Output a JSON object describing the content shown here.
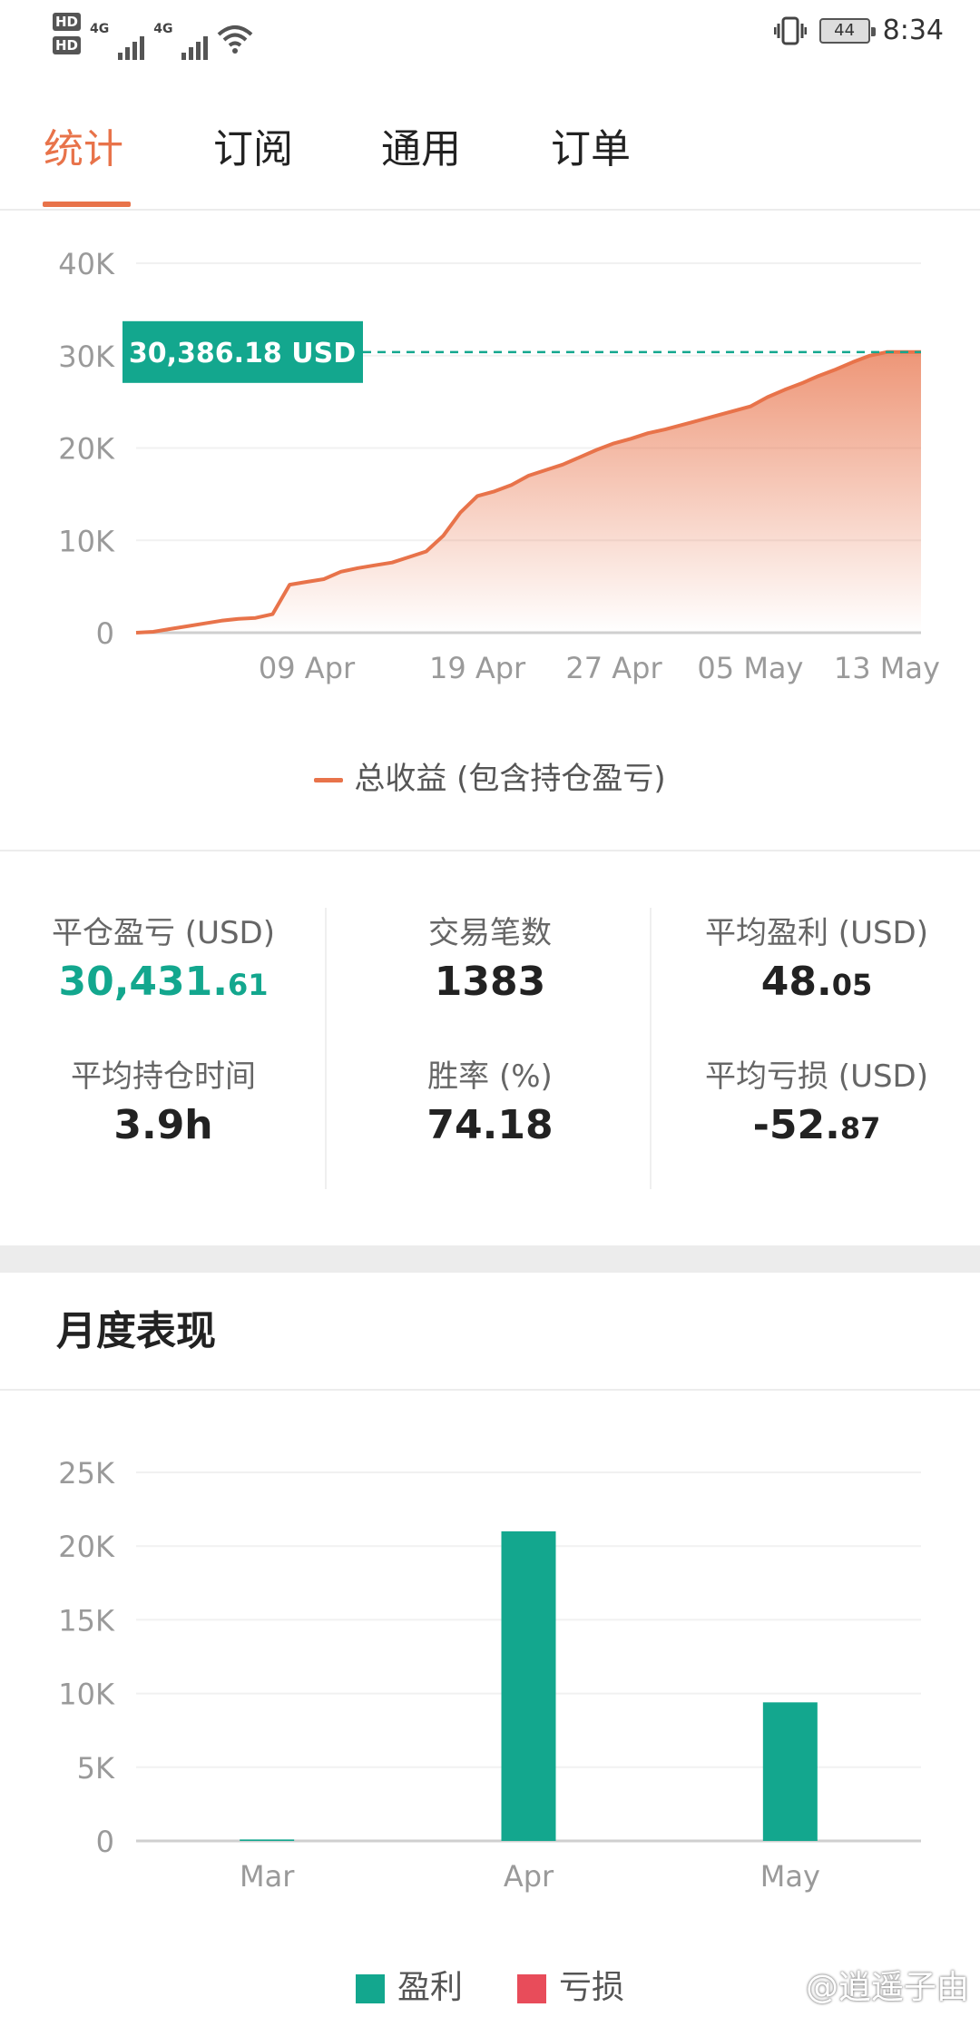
{
  "status_bar": {
    "hd1": "HD",
    "hd2": "HD",
    "network1": "4G",
    "network2": "4G",
    "battery": "44",
    "time": "8:34"
  },
  "tabs": [
    {
      "label": "统计",
      "active": true
    },
    {
      "label": "订阅",
      "active": false
    },
    {
      "label": "通用",
      "active": false
    },
    {
      "label": "订单",
      "active": false
    }
  ],
  "chart_data": [
    {
      "type": "area",
      "y_ticks": [
        "40K",
        "30K",
        "20K",
        "10K",
        "0"
      ],
      "ylim": [
        0,
        40000
      ],
      "x_ticks": [
        "09 Apr",
        "19 Apr",
        "27 Apr",
        "05 May",
        "13 May"
      ],
      "x_tick_index": [
        10,
        20,
        28,
        36,
        44
      ],
      "x_count": 47,
      "values": [
        0,
        100,
        400,
        700,
        1000,
        1300,
        1500,
        1600,
        2000,
        5200,
        5500,
        5800,
        6600,
        7000,
        7300,
        7600,
        8200,
        8800,
        10500,
        13000,
        14800,
        15300,
        16000,
        17000,
        17600,
        18200,
        19000,
        19800,
        20500,
        21000,
        21600,
        22000,
        22500,
        23000,
        23500,
        24000,
        24500,
        25500,
        26300,
        27000,
        27800,
        28500,
        29300,
        30000,
        30386,
        30386,
        30386
      ],
      "marker_label": "30,386.18 USD",
      "marker_value": 30386.18,
      "line_color": "#e8734a",
      "marker_color": "#13a78e",
      "legend": "总收益 (包含持仓盈亏)",
      "grid": true
    },
    {
      "type": "bar",
      "categories": [
        "Mar",
        "Apr",
        "May"
      ],
      "series": [
        {
          "name": "盈利",
          "values": [
            100,
            21000,
            9400
          ],
          "color": "#13a78e"
        },
        {
          "name": "亏损",
          "values": [
            0,
            0,
            0
          ],
          "color": "#e84c5a"
        }
      ],
      "y_ticks": [
        "25K",
        "20K",
        "15K",
        "10K",
        "5K",
        "0"
      ],
      "ylim": [
        0,
        25000
      ],
      "grid": true
    }
  ],
  "stats": {
    "close_pnl": {
      "label": "平仓盈亏 (USD)",
      "int": "30,431.",
      "dec": "61"
    },
    "trade_count": {
      "label": "交易笔数",
      "value": "1383"
    },
    "avg_profit": {
      "label": "平均盈利 (USD)",
      "int": "48.",
      "dec": "05"
    },
    "avg_hold_time": {
      "label": "平均持仓时间",
      "value": "3.9h"
    },
    "win_rate": {
      "label": "胜率 (%)",
      "value": "74.18"
    },
    "avg_loss": {
      "label": "平均亏损 (USD)",
      "int": "-52.",
      "dec": "87"
    }
  },
  "monthly": {
    "title": "月度表现"
  },
  "watermark": "@逍遥子由"
}
